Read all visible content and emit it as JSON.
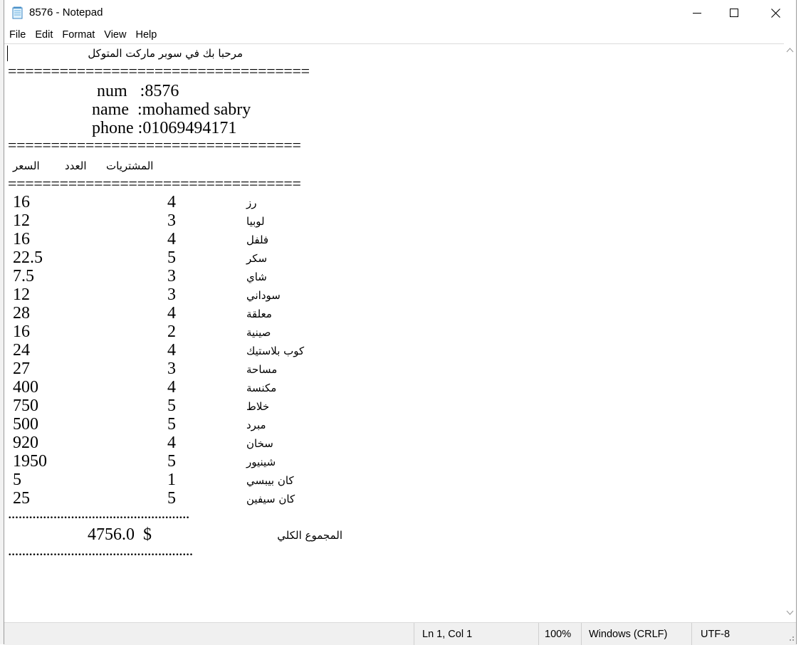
{
  "window": {
    "title": "8576 - Notepad"
  },
  "menu": [
    "File",
    "Edit",
    "Format",
    "View",
    "Help"
  ],
  "document": {
    "welcome": "مرحبا بك في سوبر ماركت المتوكل",
    "separator1": "===================================",
    "num_line": "num   :8576",
    "name_line": "name  :mohamed sabry",
    "phone_line": "phone :01069494171",
    "separator2": "==================================",
    "header_price": "السعر",
    "header_qty": "العدد",
    "header_item": "المشتريات",
    "separator3": "==================================",
    "items": [
      {
        "price": "16",
        "qty": "4",
        "name": "رز"
      },
      {
        "price": "12",
        "qty": "3",
        "name": "لوبيا"
      },
      {
        "price": "16",
        "qty": "4",
        "name": "فلفل"
      },
      {
        "price": "22.5",
        "qty": "5",
        "name": "سكر"
      },
      {
        "price": "7.5",
        "qty": "3",
        "name": "شاي"
      },
      {
        "price": "12",
        "qty": "3",
        "name": "سوداني"
      },
      {
        "price": "28",
        "qty": "4",
        "name": "معلقة"
      },
      {
        "price": "16",
        "qty": "2",
        "name": "صينية"
      },
      {
        "price": "24",
        "qty": "4",
        "name": "كوب بلاستيك"
      },
      {
        "price": "27",
        "qty": "3",
        "name": "مساحة"
      },
      {
        "price": "400",
        "qty": "4",
        "name": "مكنسة"
      },
      {
        "price": "750",
        "qty": "5",
        "name": "خلاط"
      },
      {
        "price": "500",
        "qty": "5",
        "name": "مبرد"
      },
      {
        "price": "920",
        "qty": "4",
        "name": "سخان"
      },
      {
        "price": "1950",
        "qty": "5",
        "name": "شينيور"
      },
      {
        "price": "5",
        "qty": "1",
        "name": "كان بيبسي"
      },
      {
        "price": "25",
        "qty": "5",
        "name": "كان سيفين"
      }
    ],
    "dots1": "....................................................",
    "total_value": "4756.0  $",
    "total_label": "المجموع الكلي",
    "dots2": "....................................................."
  },
  "status": {
    "position": "Ln 1, Col 1",
    "zoom": "100%",
    "line_ending": "Windows (CRLF)",
    "encoding": "UTF-8"
  }
}
